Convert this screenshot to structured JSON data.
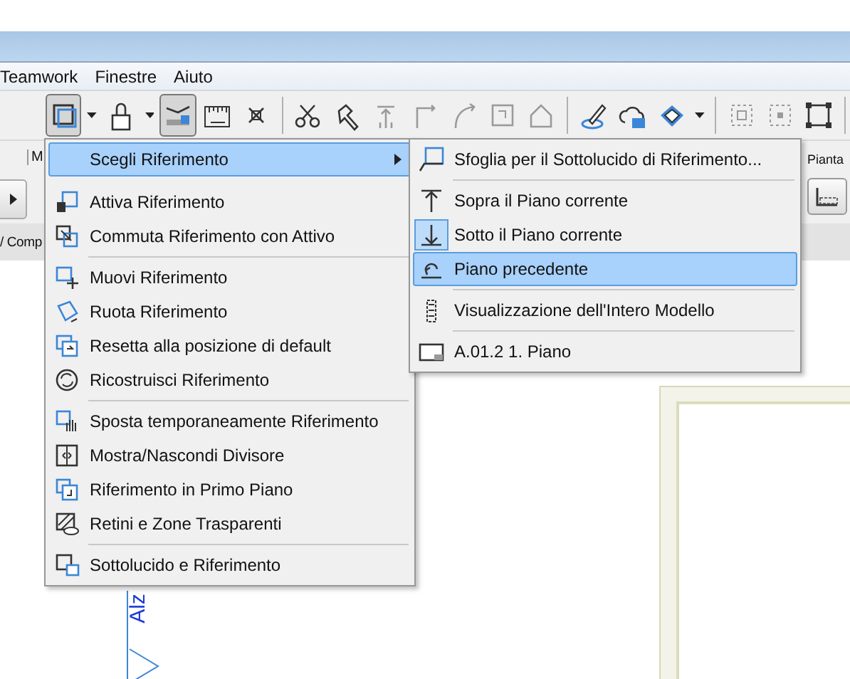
{
  "menu_bar": [
    {
      "label": "Teamwork"
    },
    {
      "label": "Finestre"
    },
    {
      "label": "Aiuto"
    }
  ],
  "toolbar": [
    {
      "pressed": true
    },
    {
      "pressed": false
    },
    {
      "pressed": true
    },
    {
      "pressed": false
    },
    {
      "pressed": false
    },
    {
      "pressed": false
    },
    {
      "pressed": false
    },
    {
      "pressed": false
    },
    {
      "pressed": false
    },
    {
      "pressed": false
    },
    {
      "pressed": false
    },
    {
      "pressed": false
    },
    {
      "pressed": false
    },
    {
      "pressed": false
    },
    {
      "pressed": false
    },
    {
      "pressed": false
    },
    {
      "pressed": false
    },
    {
      "pressed": false
    }
  ],
  "info_box": {
    "left_label": "M",
    "right_label": "Pianta"
  },
  "tab_strip": {
    "label": "/ Comp"
  },
  "canvas": {
    "vertical_label": "Alz"
  },
  "menu": {
    "items": [
      {
        "kind": "item",
        "label": "Scegli Riferimento",
        "selected": true,
        "submenu": true
      },
      {
        "kind": "item",
        "label": "Attiva Riferimento",
        "selected": false,
        "submenu": false
      },
      {
        "kind": "item",
        "label": "Commuta Riferimento con Attivo",
        "selected": false,
        "submenu": false
      },
      {
        "kind": "separator"
      },
      {
        "kind": "item",
        "label": "Muovi Riferimento",
        "selected": false,
        "submenu": false
      },
      {
        "kind": "item",
        "label": "Ruota Riferimento",
        "selected": false,
        "submenu": false
      },
      {
        "kind": "item",
        "label": "Resetta alla posizione di default",
        "selected": false,
        "submenu": false
      },
      {
        "kind": "item",
        "label": "Ricostruisci Riferimento",
        "selected": false,
        "submenu": false
      },
      {
        "kind": "separator"
      },
      {
        "kind": "item",
        "label": "Sposta temporaneamente Riferimento",
        "selected": false,
        "submenu": false
      },
      {
        "kind": "item",
        "label": "Mostra/Nascondi Divisore",
        "selected": false,
        "submenu": false
      },
      {
        "kind": "item",
        "label": "Riferimento in Primo Piano",
        "selected": false,
        "submenu": false
      },
      {
        "kind": "item",
        "label": "Retini e Zone Trasparenti",
        "selected": false,
        "submenu": false
      },
      {
        "kind": "separator"
      },
      {
        "kind": "item",
        "label": "Sottolucido e Riferimento",
        "selected": false,
        "submenu": false
      }
    ]
  },
  "submenu": {
    "items": [
      {
        "kind": "item",
        "label": "Sfoglia per il Sottolucido di Riferimento...",
        "selected": false,
        "checked": false
      },
      {
        "kind": "separator"
      },
      {
        "kind": "item",
        "label": "Sopra il Piano corrente",
        "selected": false,
        "checked": false
      },
      {
        "kind": "item",
        "label": "Sotto il Piano corrente",
        "selected": false,
        "checked": true
      },
      {
        "kind": "item",
        "label": "Piano precedente",
        "selected": true,
        "checked": false
      },
      {
        "kind": "separator"
      },
      {
        "kind": "item",
        "label": "Visualizzazione dell'Intero Modello",
        "selected": false,
        "checked": false
      },
      {
        "kind": "separator"
      },
      {
        "kind": "item",
        "label": "A.01.2 1. Piano",
        "selected": false,
        "checked": false
      }
    ]
  }
}
